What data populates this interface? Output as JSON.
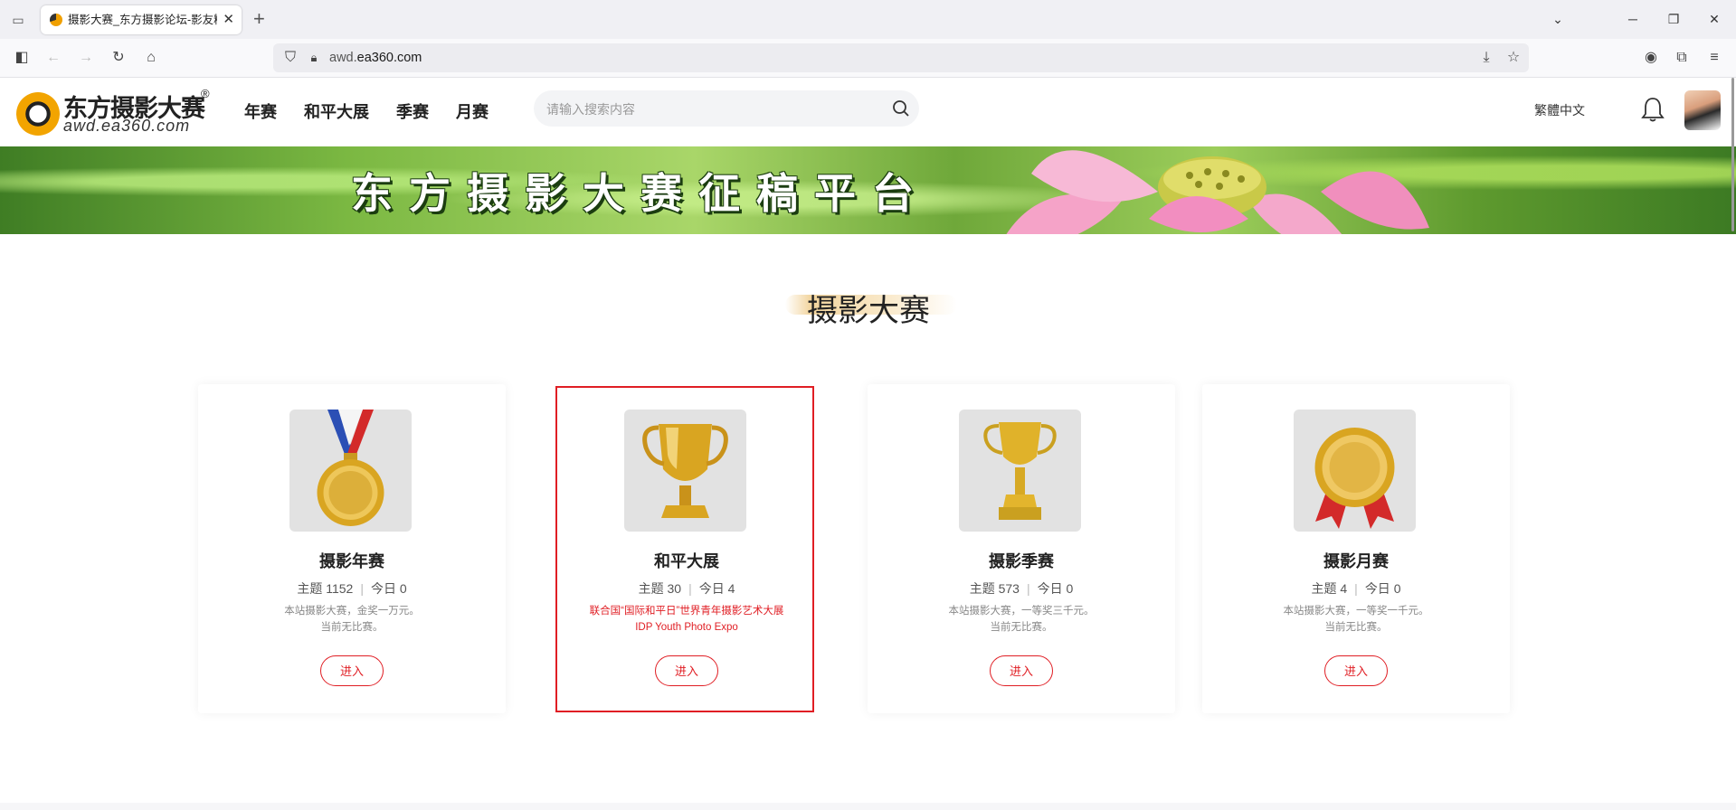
{
  "browser": {
    "tab_title": "摄影大赛_东方摄影论坛-影友精",
    "url_prefix": "awd.",
    "url_domain": "ea360.com"
  },
  "site": {
    "logo_cn": "东方摄影大赛",
    "logo_reg": "®",
    "logo_en": "awd.ea360.com",
    "menu": [
      "年赛",
      "和平大展",
      "季赛",
      "月赛"
    ],
    "search_placeholder": "请输入搜索内容",
    "language": "繁體中文"
  },
  "banner": {
    "title": "东方摄影大赛征稿平台"
  },
  "section": {
    "title": "摄影大赛"
  },
  "cards": [
    {
      "name": "摄影年赛",
      "topic_label": "主题 1152",
      "today_label": "今日 0",
      "desc_line1": "本站摄影大赛，金奖一万元。",
      "desc_line2": "当前无比赛。",
      "button": "进入",
      "image": "gold-medal-ribbon"
    },
    {
      "name": "和平大展",
      "topic_label": "主题 30",
      "today_label": "今日 4",
      "desc_line1": "联合国“国际和平日”世界青年摄影艺术大展",
      "desc_line2": "IDP Youth Photo Expo",
      "button": "进入",
      "image": "gold-trophy-cup"
    },
    {
      "name": "摄影季赛",
      "topic_label": "主题 573",
      "today_label": "今日 0",
      "desc_line1": "本站摄影大赛，一等奖三千元。",
      "desc_line2": "当前无比赛。",
      "button": "进入",
      "image": "gold-trophy-tall"
    },
    {
      "name": "摄影月赛",
      "topic_label": "主题 4",
      "today_label": "今日 0",
      "desc_line1": "本站摄影大赛，一等奖一千元。",
      "desc_line2": "当前无比赛。",
      "button": "进入",
      "image": "gold-medal-rosette"
    }
  ],
  "colors": {
    "accent": "#e01e24",
    "gold": "#d9a521"
  }
}
